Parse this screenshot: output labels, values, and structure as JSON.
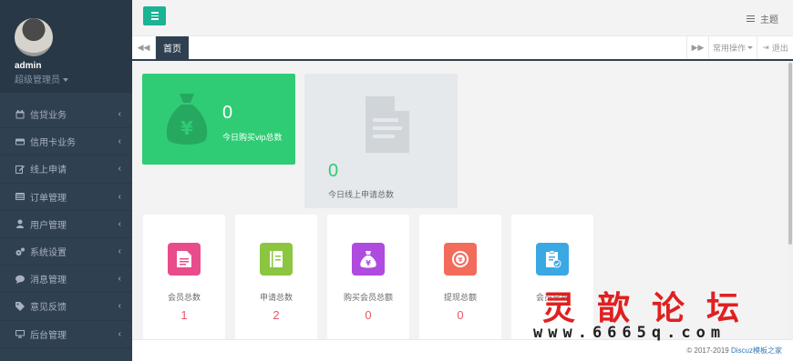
{
  "profile": {
    "username": "admin",
    "role": "超级管理员"
  },
  "nav": [
    {
      "label": "信贷业务",
      "icon": "calendar-icon"
    },
    {
      "label": "信用卡业务",
      "icon": "credit-card-icon"
    },
    {
      "label": "线上申请",
      "icon": "edit-icon"
    },
    {
      "label": "订单管理",
      "icon": "list-icon"
    },
    {
      "label": "用户管理",
      "icon": "user-icon"
    },
    {
      "label": "系统设置",
      "icon": "gears-icon"
    },
    {
      "label": "消息管理",
      "icon": "comment-icon"
    },
    {
      "label": "意见反馈",
      "icon": "tag-icon"
    },
    {
      "label": "后台管理",
      "icon": "desktop-icon"
    }
  ],
  "topbar": {
    "theme_label": "主题"
  },
  "tabs": {
    "home_label": "首页",
    "ops_label": "常用操作",
    "logout_label": "退出"
  },
  "stats": {
    "vip": {
      "value": "0",
      "label": "今日购买vip总数"
    },
    "online": {
      "value": "0",
      "label": "今日线上申请总数"
    }
  },
  "cards": [
    {
      "label": "会员总数",
      "value": "1",
      "color": "#e84c8b"
    },
    {
      "label": "申请总数",
      "value": "2",
      "color": "#8cc540"
    },
    {
      "label": "购买会员总额",
      "value": "0",
      "color": "#b04be0"
    },
    {
      "label": "提现总额",
      "value": "0",
      "color": "#f26b5b"
    },
    {
      "label": "会员总数",
      "value": "",
      "color": "#3aa8e2"
    }
  ],
  "footer": {
    "copyright": "© 2017-2019 ",
    "link_text": "Discuz模板之家"
  },
  "watermark": {
    "title": "灵歆论坛",
    "url": "www.6665q.com"
  },
  "colors": {
    "sidebar": "#2f4050",
    "accent": "#1ab394",
    "green": "#2fcc75"
  }
}
